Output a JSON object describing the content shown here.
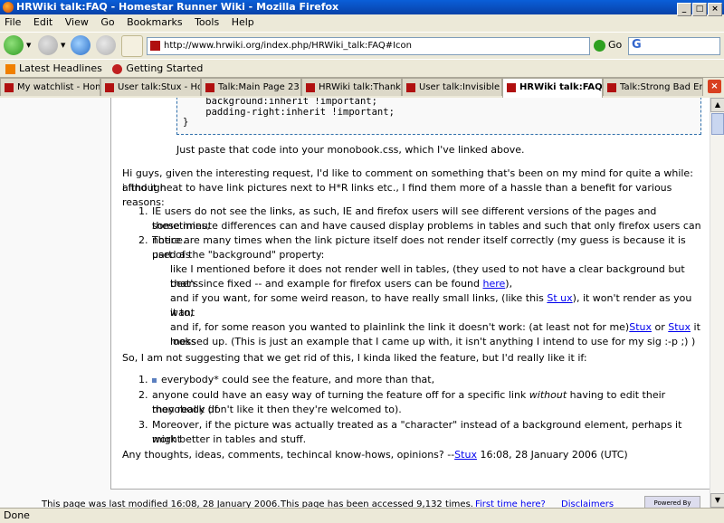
{
  "window": {
    "title": "HRWiki talk:FAQ - Homestar Runner Wiki - Mozilla Firefox"
  },
  "menu": [
    "File",
    "Edit",
    "View",
    "Go",
    "Bookmarks",
    "Tools",
    "Help"
  ],
  "nav": {
    "url": "http://www.hrwiki.org/index.php/HRWiki_talk:FAQ#Icon",
    "go_label": "Go",
    "search_logo": "G"
  },
  "bookmarks": [
    "Latest Headlines",
    "Getting Started"
  ],
  "tabs": [
    {
      "label": "My watchlist - Home..."
    },
    {
      "label": "User talk:Stux - Ho..."
    },
    {
      "label": "Talk:Main Page 23 - ..."
    },
    {
      "label": "HRWiki talk:Thank Y..."
    },
    {
      "label": "User talk:Invisible R..."
    },
    {
      "label": "HRWiki talk:FAQ - ..."
    },
    {
      "label": "Talk:Strong Bad Em..."
    }
  ],
  "page": {
    "code_lines": "    background:inherit !important;\n    padding-right:inherit !important;\n}",
    "paste_note": "Just paste that code into your monobook.css, which I've linked above.",
    "intro": "Hi guys, given the interesting request, I'd like to comment on something that's been on my mind for quite a while: although i find it neat to have link pictures next to H*R links etc., I find them more of a hassle than a benefit for various reasons:",
    "list1": {
      "item1_n": "1.",
      "item1_a": "IE users do not see the links, as such, IE and firefox users will see different versions of the pages and sometimes,",
      "item1_b": "these minute differences can and have caused display problems in tables and such that only firefox users can notice.",
      "item2_n": "2.",
      "item2_a": "There are many times when the link picture itself does not render itself correctly (my guess is because it is used as",
      "item2_b": "part of the \"background\" property:",
      "sub1_a": "like I mentioned before it does not render well in tables, (they used to not have a clear background but that's",
      "sub1_b": "been since fixed -- and example for firefox users can be found",
      "sub1_link": "here",
      "sub1_end": "),",
      "sub2_a": "and if you want, for some weird reason, to have really small links, (like this",
      "sub2_link": "St  ux",
      "sub2_end": "), it won't render as you want",
      "sub2_b": "it to,",
      "sub3_a": "and if, for some reason you wanted to plainlink the link it doesn't work: (at least not for me)",
      "sub3_link1": "Stux",
      "sub3_or": " or ",
      "sub3_link2": "Stux",
      "sub3_end": " it looks",
      "sub3_b": "messed up. (This is just an example that I came up with, it isn't anything I intend to use for my sig :-p ;) )"
    },
    "summary": "So, I am not suggesting that we get rid of this, I kinda liked the feature, but I'd really like it if:",
    "list2": {
      "item1_n": "1.",
      "item1": "everybody* could see the feature, and more than that,",
      "item2_n": "2.",
      "item2_a": "anyone could have an easy way of turning the feature off for a specific link",
      "item2_em": "without",
      "item2_end": " having to edit their monobook (if",
      "item2_b": "they really don't like it then they're welcomed to).",
      "item3_n": "3.",
      "item3_a": "Moreover, if the picture was actually treated as a \"character\" instead of a background element, perhaps it might",
      "item3_b": "work better in tables and stuff."
    },
    "closing_text": "Any thoughts, ideas, comments, techincal know-hows, opinions? --",
    "sig_link": "Stux",
    "sig_time": " 16:08, 28 January 2006 (UTC)"
  },
  "footer": {
    "modified": "This page was last modified 16:08, 28 January 2006.",
    "accessed": "This page has been accessed 9,132 times.",
    "first_time": "First time here?",
    "disclaimers": "Disclaimers",
    "badge": "Powered By"
  },
  "status": "Done"
}
